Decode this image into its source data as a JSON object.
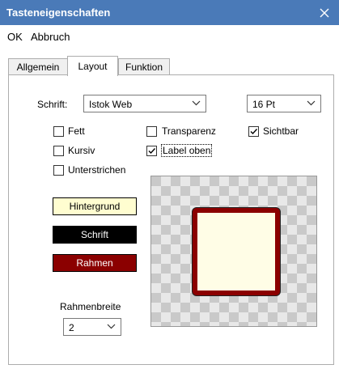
{
  "window": {
    "title": "Tasteneigenschaften",
    "close_glyph": "✕"
  },
  "menu": {
    "ok": "OK",
    "cancel": "Abbruch"
  },
  "tabs": [
    {
      "label": "Allgemein",
      "active": false
    },
    {
      "label": "Layout",
      "active": true
    },
    {
      "label": "Funktion",
      "active": false
    }
  ],
  "font": {
    "label": "Schrift:",
    "family": "Istok Web",
    "size": "16 Pt"
  },
  "checkboxes": {
    "bold": {
      "label": "Fett",
      "checked": false
    },
    "italic": {
      "label": "Kursiv",
      "checked": false
    },
    "underline": {
      "label": "Unterstrichen",
      "checked": false
    },
    "transparent": {
      "label": "Transparenz",
      "checked": false
    },
    "label_top": {
      "label": "Label oben",
      "checked": true
    },
    "visible": {
      "label": "Sichtbar",
      "checked": true
    }
  },
  "color_buttons": {
    "background": {
      "label": "Hintergrund",
      "bg": "#fffdd0",
      "fg": "#000000"
    },
    "font": {
      "label": "Schrift",
      "bg": "#000000",
      "fg": "#ffffff"
    },
    "frame": {
      "label": "Rahmen",
      "bg": "#8b0000",
      "fg": "#ffffff"
    }
  },
  "frame_width": {
    "label": "Rahmenbreite",
    "value": "2"
  },
  "preview": {
    "fill": "#fffde6",
    "border": "#8b0000"
  },
  "colors": {
    "titlebar": "#4a7ab8",
    "accent_check": "#000000"
  }
}
